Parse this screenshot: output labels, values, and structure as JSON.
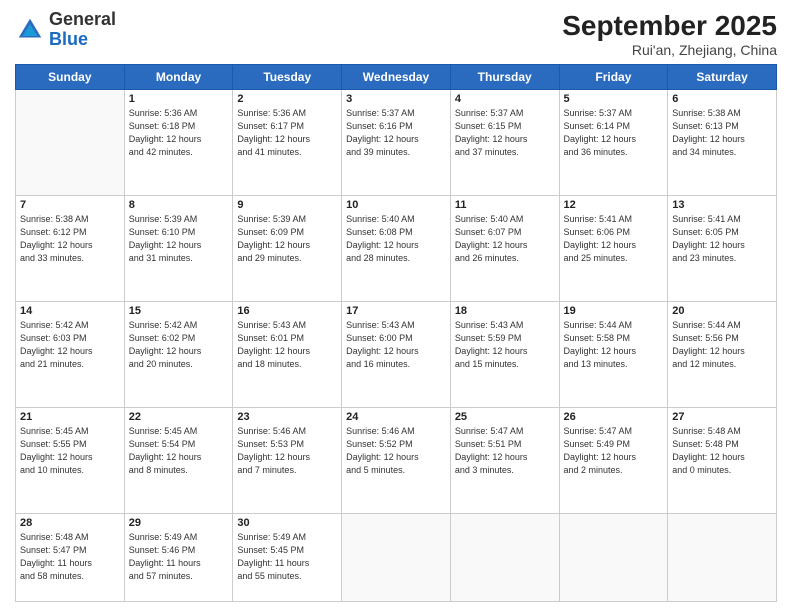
{
  "header": {
    "logo": {
      "line1": "General",
      "line2": "Blue"
    },
    "title": "September 2025",
    "subtitle": "Rui'an, Zhejiang, China"
  },
  "weekdays": [
    "Sunday",
    "Monday",
    "Tuesday",
    "Wednesday",
    "Thursday",
    "Friday",
    "Saturday"
  ],
  "weeks": [
    [
      {
        "day": "",
        "info": ""
      },
      {
        "day": "1",
        "info": "Sunrise: 5:36 AM\nSunset: 6:18 PM\nDaylight: 12 hours\nand 42 minutes."
      },
      {
        "day": "2",
        "info": "Sunrise: 5:36 AM\nSunset: 6:17 PM\nDaylight: 12 hours\nand 41 minutes."
      },
      {
        "day": "3",
        "info": "Sunrise: 5:37 AM\nSunset: 6:16 PM\nDaylight: 12 hours\nand 39 minutes."
      },
      {
        "day": "4",
        "info": "Sunrise: 5:37 AM\nSunset: 6:15 PM\nDaylight: 12 hours\nand 37 minutes."
      },
      {
        "day": "5",
        "info": "Sunrise: 5:37 AM\nSunset: 6:14 PM\nDaylight: 12 hours\nand 36 minutes."
      },
      {
        "day": "6",
        "info": "Sunrise: 5:38 AM\nSunset: 6:13 PM\nDaylight: 12 hours\nand 34 minutes."
      }
    ],
    [
      {
        "day": "7",
        "info": "Sunrise: 5:38 AM\nSunset: 6:12 PM\nDaylight: 12 hours\nand 33 minutes."
      },
      {
        "day": "8",
        "info": "Sunrise: 5:39 AM\nSunset: 6:10 PM\nDaylight: 12 hours\nand 31 minutes."
      },
      {
        "day": "9",
        "info": "Sunrise: 5:39 AM\nSunset: 6:09 PM\nDaylight: 12 hours\nand 29 minutes."
      },
      {
        "day": "10",
        "info": "Sunrise: 5:40 AM\nSunset: 6:08 PM\nDaylight: 12 hours\nand 28 minutes."
      },
      {
        "day": "11",
        "info": "Sunrise: 5:40 AM\nSunset: 6:07 PM\nDaylight: 12 hours\nand 26 minutes."
      },
      {
        "day": "12",
        "info": "Sunrise: 5:41 AM\nSunset: 6:06 PM\nDaylight: 12 hours\nand 25 minutes."
      },
      {
        "day": "13",
        "info": "Sunrise: 5:41 AM\nSunset: 6:05 PM\nDaylight: 12 hours\nand 23 minutes."
      }
    ],
    [
      {
        "day": "14",
        "info": "Sunrise: 5:42 AM\nSunset: 6:03 PM\nDaylight: 12 hours\nand 21 minutes."
      },
      {
        "day": "15",
        "info": "Sunrise: 5:42 AM\nSunset: 6:02 PM\nDaylight: 12 hours\nand 20 minutes."
      },
      {
        "day": "16",
        "info": "Sunrise: 5:43 AM\nSunset: 6:01 PM\nDaylight: 12 hours\nand 18 minutes."
      },
      {
        "day": "17",
        "info": "Sunrise: 5:43 AM\nSunset: 6:00 PM\nDaylight: 12 hours\nand 16 minutes."
      },
      {
        "day": "18",
        "info": "Sunrise: 5:43 AM\nSunset: 5:59 PM\nDaylight: 12 hours\nand 15 minutes."
      },
      {
        "day": "19",
        "info": "Sunrise: 5:44 AM\nSunset: 5:58 PM\nDaylight: 12 hours\nand 13 minutes."
      },
      {
        "day": "20",
        "info": "Sunrise: 5:44 AM\nSunset: 5:56 PM\nDaylight: 12 hours\nand 12 minutes."
      }
    ],
    [
      {
        "day": "21",
        "info": "Sunrise: 5:45 AM\nSunset: 5:55 PM\nDaylight: 12 hours\nand 10 minutes."
      },
      {
        "day": "22",
        "info": "Sunrise: 5:45 AM\nSunset: 5:54 PM\nDaylight: 12 hours\nand 8 minutes."
      },
      {
        "day": "23",
        "info": "Sunrise: 5:46 AM\nSunset: 5:53 PM\nDaylight: 12 hours\nand 7 minutes."
      },
      {
        "day": "24",
        "info": "Sunrise: 5:46 AM\nSunset: 5:52 PM\nDaylight: 12 hours\nand 5 minutes."
      },
      {
        "day": "25",
        "info": "Sunrise: 5:47 AM\nSunset: 5:51 PM\nDaylight: 12 hours\nand 3 minutes."
      },
      {
        "day": "26",
        "info": "Sunrise: 5:47 AM\nSunset: 5:49 PM\nDaylight: 12 hours\nand 2 minutes."
      },
      {
        "day": "27",
        "info": "Sunrise: 5:48 AM\nSunset: 5:48 PM\nDaylight: 12 hours\nand 0 minutes."
      }
    ],
    [
      {
        "day": "28",
        "info": "Sunrise: 5:48 AM\nSunset: 5:47 PM\nDaylight: 11 hours\nand 58 minutes."
      },
      {
        "day": "29",
        "info": "Sunrise: 5:49 AM\nSunset: 5:46 PM\nDaylight: 11 hours\nand 57 minutes."
      },
      {
        "day": "30",
        "info": "Sunrise: 5:49 AM\nSunset: 5:45 PM\nDaylight: 11 hours\nand 55 minutes."
      },
      {
        "day": "",
        "info": ""
      },
      {
        "day": "",
        "info": ""
      },
      {
        "day": "",
        "info": ""
      },
      {
        "day": "",
        "info": ""
      }
    ]
  ]
}
